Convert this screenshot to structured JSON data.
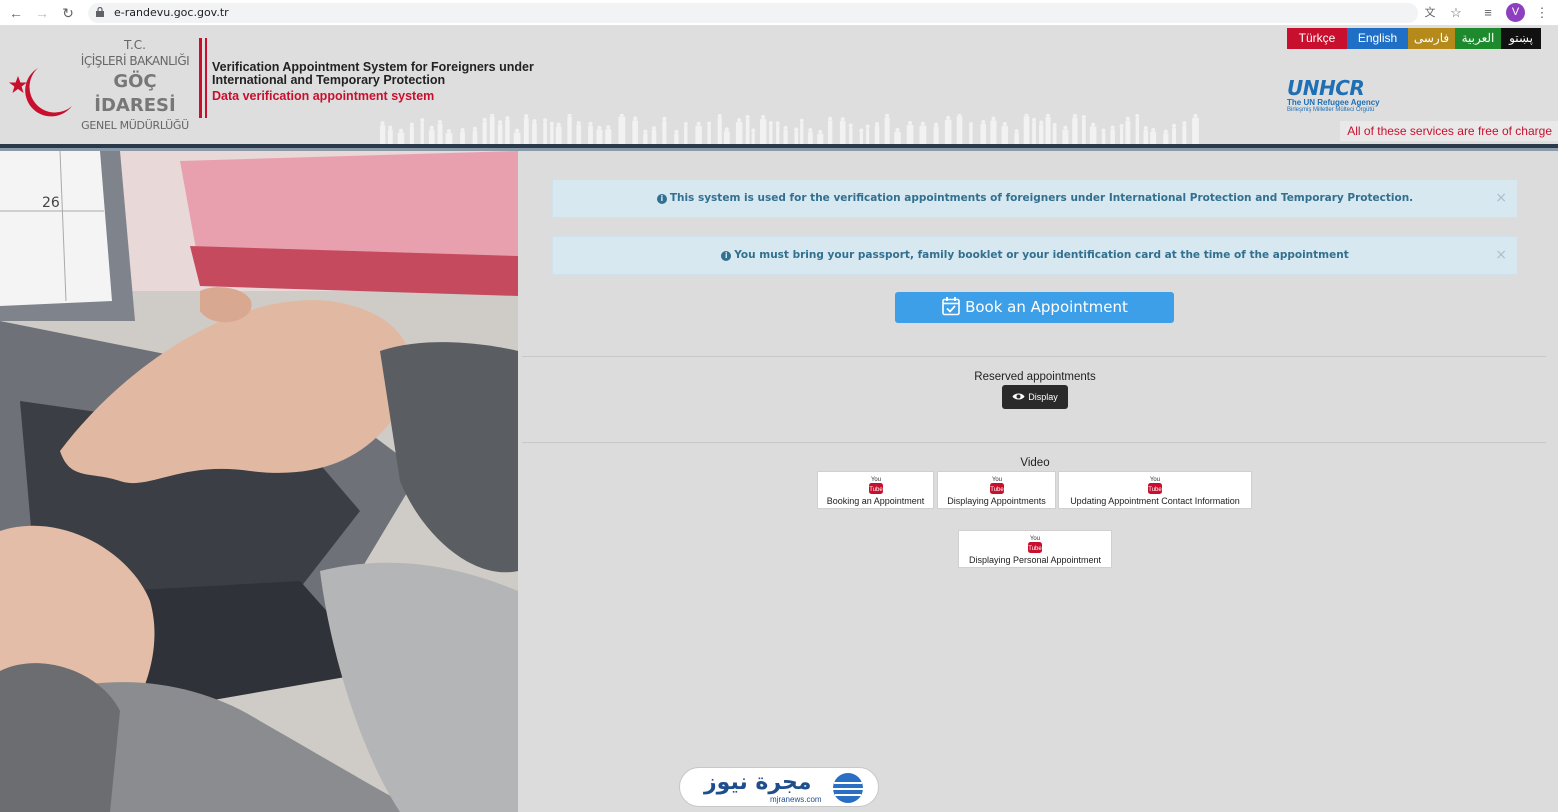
{
  "browser": {
    "url": "e-randevu.goc.gov.tr",
    "avatar_letter": "V"
  },
  "header": {
    "logo": {
      "line1": "T.C.",
      "line2": "İÇİŞLERİ BAKANLIĞI",
      "line3": "GÖÇ İDARESİ",
      "line4": "GENEL MÜDÜRLÜĞÜ"
    },
    "system_title_line1": "Verification Appointment System for Foreigners under",
    "system_title_line2": "International and Temporary Protection",
    "system_subtitle": "Data verification appointment system",
    "languages": [
      {
        "label": "Türkçe",
        "color": "#c8102e"
      },
      {
        "label": "English",
        "color": "#1f6fc7"
      },
      {
        "label": "فارسی",
        "color": "#b58a1a"
      },
      {
        "label": "العربية",
        "color": "#1d8a2e"
      },
      {
        "label": "پښتو",
        "color": "#111111"
      }
    ],
    "unhcr": {
      "name": "UNHCR",
      "sub1": "The UN Refugee Agency",
      "sub2": "Birleşmiş Milletler Mülteci Örgütü"
    },
    "free_note": "All of these services are free of charge"
  },
  "main": {
    "alerts": [
      {
        "text": "This system is used for the verification appointments of foreigners under International Protection and Temporary Protection.",
        "close": "×"
      },
      {
        "text": "You must bring your passport, family booklet or your identification card at the time of the appointment",
        "close": "×"
      }
    ],
    "book_button": "Book an Appointment",
    "reserved_label": "Reserved appointments",
    "display_button": "Display",
    "video_label": "Video",
    "videos": [
      {
        "label": "Booking an Appointment"
      },
      {
        "label": "Displaying Appointments"
      },
      {
        "label": "Updating Appointment Contact Information"
      },
      {
        "label": "Displaying Personal Appointment"
      }
    ],
    "youtube_you": "You",
    "youtube_tube": "Tube"
  },
  "watermark": {
    "arabic": "مجرة نيوز",
    "latin": "mjranews.com"
  },
  "colors": {
    "accent": "#3d9fe8",
    "alert_bg": "#d8e8f0",
    "alert_text": "#31708f",
    "brand_red": "#c8102e"
  }
}
